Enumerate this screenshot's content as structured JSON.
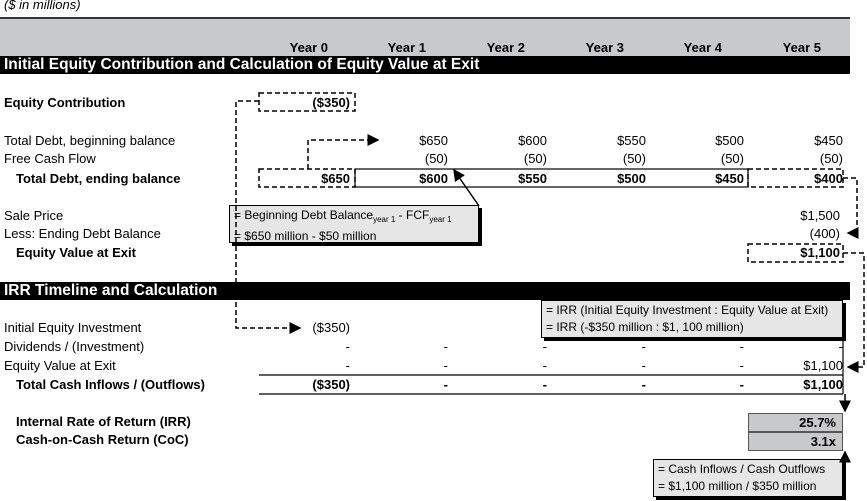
{
  "units_note": "($ in millions)",
  "years": [
    "Year 0",
    "Year 1",
    "Year 2",
    "Year 3",
    "Year 4",
    "Year 5"
  ],
  "section1": {
    "title": "Initial Equity Contribution and Calculation of Equity Value at Exit",
    "equity_contribution": {
      "label": "Equity Contribution",
      "value": "($350)"
    },
    "debt_beginning": {
      "label": "Total Debt, beginning balance",
      "values": [
        "",
        "$650",
        "$600",
        "$550",
        "$500",
        "$450"
      ]
    },
    "free_cash_flow": {
      "label": "Free Cash Flow",
      "values": [
        "",
        "(50)",
        "(50)",
        "(50)",
        "(50)",
        "(50)"
      ]
    },
    "debt_ending": {
      "label": "Total Debt, ending balance",
      "values": [
        "$650",
        "$600",
        "$550",
        "$500",
        "$450",
        "$400"
      ]
    },
    "sale_price": {
      "label": "Sale Price",
      "value": "$1,500"
    },
    "less_ending_debt": {
      "label": "Less: Ending Debt Balance",
      "value": "(400)"
    },
    "equity_value_exit": {
      "label": "Equity Value at Exit",
      "value": "$1,100"
    },
    "callout": {
      "line1_prefix": "= Beginning Debt Balance",
      "line1_sub1": "year 1",
      "line1_mid": " - FCF",
      "line1_sub2": "year 1",
      "line2": "= $650 million - $50 million"
    }
  },
  "section2": {
    "title": "IRR Timeline and Calculation",
    "initial_equity": {
      "label": "Initial Equity Investment",
      "values": [
        "($350)",
        "",
        "",
        "",
        "",
        ""
      ]
    },
    "dividends": {
      "label": "Dividends / (Investment)",
      "values": [
        "-",
        "-",
        "-",
        "-",
        "-",
        "-"
      ]
    },
    "equity_exit": {
      "label": "Equity Value at Exit",
      "values": [
        "-",
        "-",
        "-",
        "-",
        "-",
        "$1,100"
      ]
    },
    "total": {
      "label": "Total Cash Inflows / (Outflows)",
      "values": [
        "($350)",
        "-",
        "-",
        "-",
        "-",
        "$1,100"
      ]
    },
    "irr_callout": {
      "line1": "= IRR (Initial Equity Investment : Equity Value at Exit)",
      "line2": "= IRR (-$350 million : $1, 100 million)"
    },
    "irr": {
      "label": "Internal Rate of Return (IRR)",
      "value": "25.7%"
    },
    "coc": {
      "label": "Cash-on-Cash Return (CoC)",
      "value": "3.1x"
    },
    "coc_callout": {
      "line1": "= Cash Inflows / Cash Outflows",
      "line2": "= $1,100 million / $350 million"
    }
  }
}
